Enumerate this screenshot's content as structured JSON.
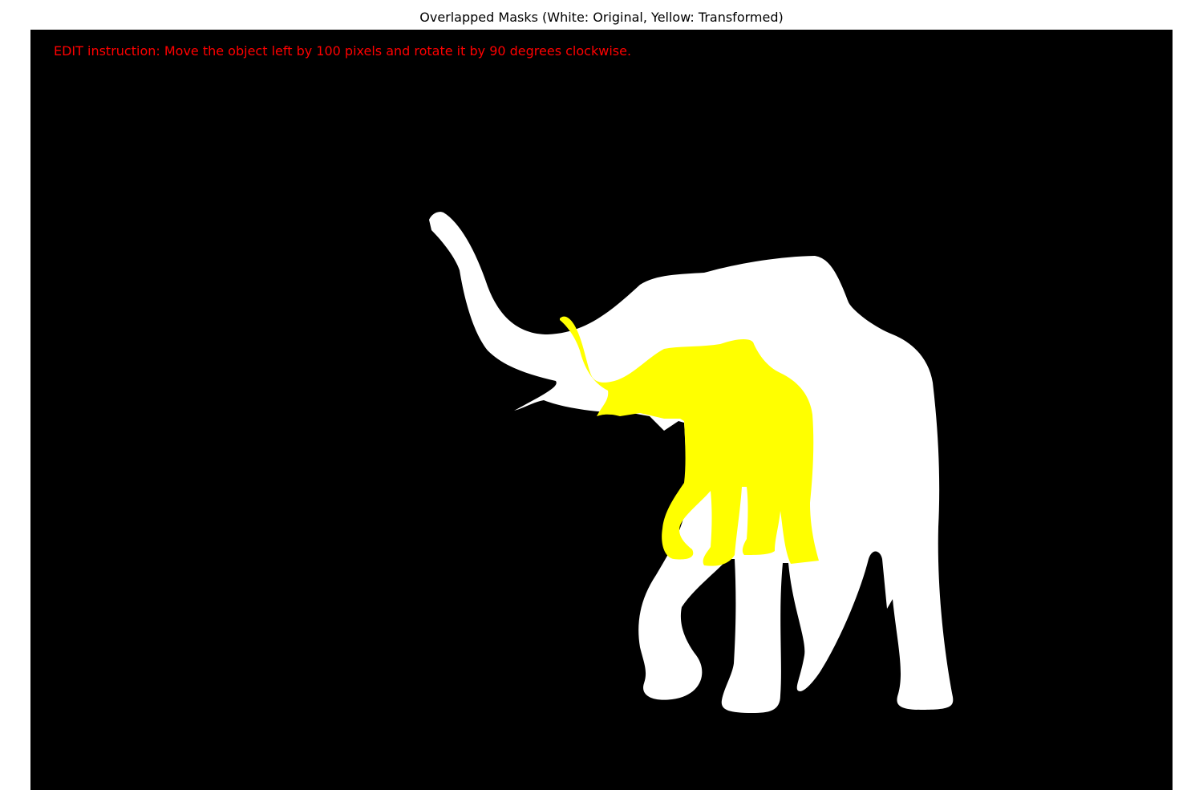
{
  "figure": {
    "title": "Overlapped Masks (White: Original, Yellow: Transformed)"
  },
  "instruction": {
    "text": "EDIT instruction: Move the object left by 100 pixels and rotate it by 90 degrees clockwise.",
    "color": "#ff0000"
  },
  "colors": {
    "background": "#000000",
    "original_mask": "#ffffff",
    "transformed_mask": "#ffff00"
  },
  "masks": [
    {
      "name": "original",
      "subject": "elephant",
      "color": "#ffffff"
    },
    {
      "name": "transformed",
      "subject": "elephant",
      "color": "#ffff00"
    }
  ]
}
